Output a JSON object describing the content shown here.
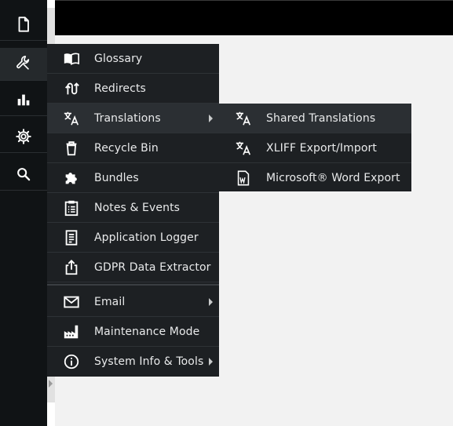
{
  "rail": {
    "items": [
      {
        "icon": "document-icon"
      },
      {
        "icon": "wrench-icon",
        "active": true
      },
      {
        "icon": "bar-chart-icon"
      },
      {
        "icon": "gear-icon"
      },
      {
        "icon": "search-icon"
      }
    ]
  },
  "main_menu": {
    "items": [
      {
        "icon": "book-icon",
        "label": "Glossary"
      },
      {
        "icon": "redirect-icon",
        "label": "Redirects"
      },
      {
        "icon": "translate-icon",
        "label": "Translations",
        "has_submenu": true,
        "highlighted": true
      },
      {
        "icon": "trash-icon",
        "label": "Recycle Bin"
      },
      {
        "icon": "puzzle-icon",
        "label": "Bundles"
      },
      {
        "icon": "clipboard-icon",
        "label": "Notes & Events"
      },
      {
        "icon": "log-icon",
        "label": "Application Logger"
      },
      {
        "icon": "export-icon",
        "label": "GDPR Data Extractor"
      },
      {
        "icon": "mail-icon",
        "label": "Email",
        "has_submenu": true
      },
      {
        "icon": "factory-icon",
        "label": "Maintenance Mode"
      },
      {
        "icon": "info-icon",
        "label": "System Info & Tools",
        "has_submenu": true
      }
    ]
  },
  "sub_menu": {
    "items": [
      {
        "icon": "translate-icon",
        "label": "Shared Translations",
        "highlighted": true
      },
      {
        "icon": "translate-icon",
        "label": "XLIFF Export/Import"
      },
      {
        "icon": "word-document-icon",
        "label": "Microsoft® Word Export"
      }
    ]
  },
  "colors": {
    "rail_bg": "#101315",
    "menu_bg": "#1d2023",
    "menu_hover": "#2b2f33",
    "menu_text": "#e9eaeb",
    "topbar": "#000000",
    "content_bg": "#f2f2f2"
  }
}
